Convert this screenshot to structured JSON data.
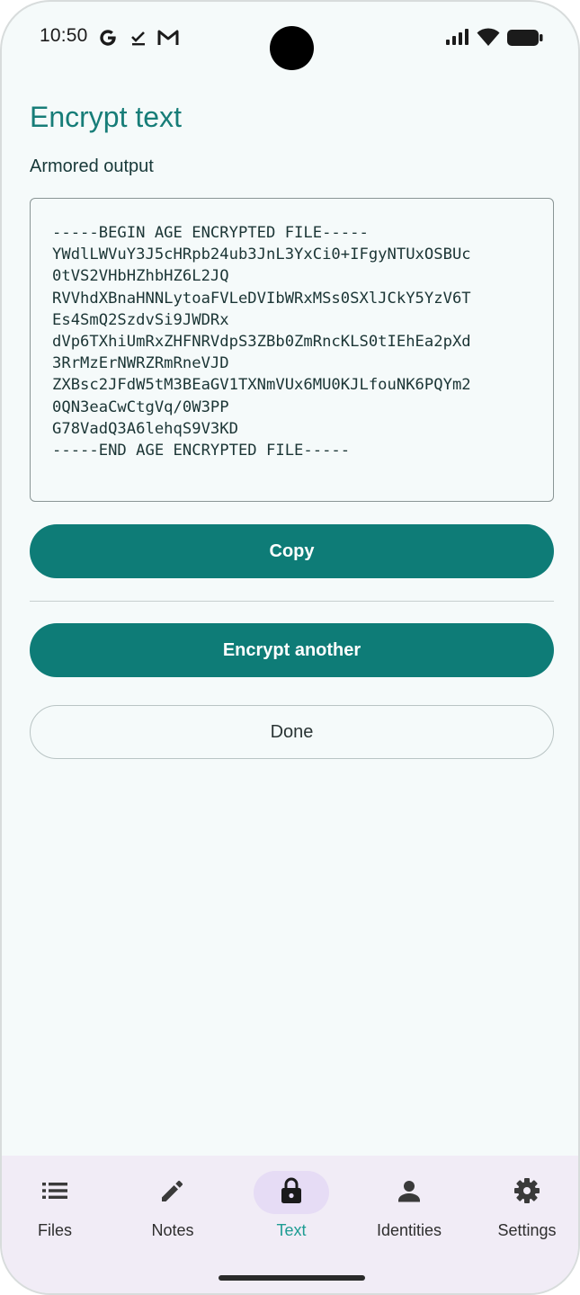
{
  "status_bar": {
    "time": "10:50",
    "notification_icons": [
      "google-g-icon",
      "checkmark-icon",
      "gmail-icon"
    ],
    "system_icons": [
      "signal-icon",
      "wifi-icon",
      "battery-icon"
    ]
  },
  "header": {
    "title": "Encrypt text"
  },
  "output": {
    "label": "Armored output",
    "armored_text": "-----BEGIN AGE ENCRYPTED FILE-----\nYWdlLWVuY3J5cHRpb24ub3JnL3YxCi0+IFgyNTUxOSBUc\n0tVS2VHbHZhbHZ6L2JQ\nRVVhdXBnaHNNLytoaFVLeDVIbWRxMSs0SXlJCkY5YzV6T\nEs4SmQ2SzdvSi9JWDRx\ndVp6TXhiUmRxZHFNRVdpS3ZBb0ZmRncKLS0tIEhEa2pXd\n3RrMzErNWRZRmRneVJD\nZXBsc2JFdW5tM3BEaGV1TXNmVUx6MU0KJLfouNK6PQYm2\n0QN3eaCwCtgVq/0W3PP\nG78VadQ3A6lehqS9V3KD\n-----END AGE ENCRYPTED FILE-----"
  },
  "actions": {
    "copy_label": "Copy",
    "encrypt_another_label": "Encrypt another",
    "done_label": "Done"
  },
  "colors": {
    "accent": "#0e7c77",
    "title": "#177d78",
    "nav_active_pill": "#e6dcf5",
    "nav_active_label": "#1e9c93",
    "nav_background": "#f1ecf6",
    "background": "#f5fafa"
  },
  "bottom_nav": {
    "items": [
      {
        "label": "Files",
        "icon": "list-icon",
        "active": false
      },
      {
        "label": "Notes",
        "icon": "pencil-icon",
        "active": false
      },
      {
        "label": "Text",
        "icon": "lock-icon",
        "active": true
      },
      {
        "label": "Identities",
        "icon": "person-icon",
        "active": false
      },
      {
        "label": "Settings",
        "icon": "gear-icon",
        "active": false
      }
    ]
  }
}
